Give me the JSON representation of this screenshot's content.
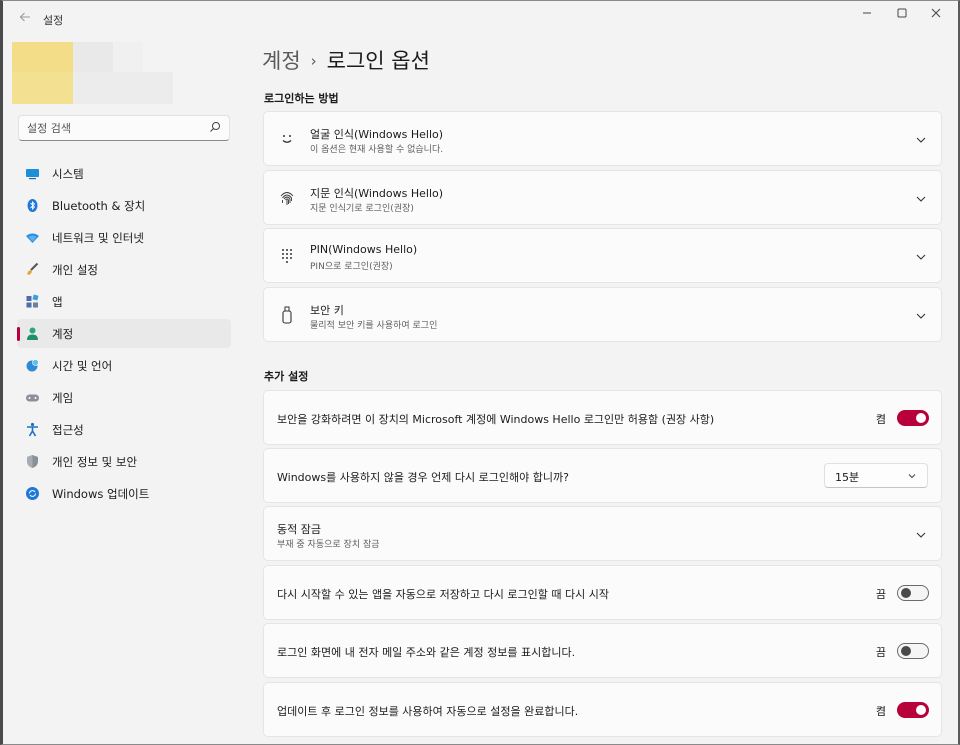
{
  "app": {
    "title": "설정"
  },
  "search": {
    "placeholder": "설정 검색"
  },
  "sidebar": {
    "items": [
      {
        "label": "시스템",
        "icon": "system-icon"
      },
      {
        "label": "Bluetooth & 장치",
        "icon": "bluetooth-icon"
      },
      {
        "label": "네트워크 및 인터넷",
        "icon": "network-icon"
      },
      {
        "label": "개인 설정",
        "icon": "brush-icon"
      },
      {
        "label": "앱",
        "icon": "apps-icon"
      },
      {
        "label": "계정",
        "icon": "account-icon",
        "active": true
      },
      {
        "label": "시간 및 언어",
        "icon": "globe-clock-icon"
      },
      {
        "label": "게임",
        "icon": "gamepad-icon"
      },
      {
        "label": "접근성",
        "icon": "accessibility-icon"
      },
      {
        "label": "개인 정보 및 보안",
        "icon": "shield-icon"
      },
      {
        "label": "Windows 업데이트",
        "icon": "update-icon"
      }
    ]
  },
  "breadcrumb": {
    "parent": "계정",
    "separator": "›",
    "current": "로그인 옵션"
  },
  "sections": {
    "signin_methods": {
      "title": "로그인하는 방법",
      "items": [
        {
          "title": "얼굴 인식(Windows Hello)",
          "subtitle": "이 옵션은 현재 사용할 수 없습니다.",
          "icon": "face-icon"
        },
        {
          "title": "지문 인식(Windows Hello)",
          "subtitle": "지문 인식기로 로그인(권장)",
          "icon": "fingerprint-icon"
        },
        {
          "title": "PIN(Windows Hello)",
          "subtitle": "PIN으로 로그인(권장)",
          "icon": "pin-keypad-icon"
        },
        {
          "title": "보안 키",
          "subtitle": "물리적 보안 키를 사용하여 로그인",
          "icon": "security-key-icon"
        }
      ]
    },
    "additional": {
      "title": "추가 설정",
      "hello_only": {
        "text": "보안을 강화하려면 이 장치의 Microsoft 계정에 Windows Hello 로그인만 허용함 (권장 사항)",
        "state": "켬",
        "on": true
      },
      "away": {
        "text": "Windows를 사용하지 않을 경우 언제 다시 로그인해야 합니까?",
        "value": "15분"
      },
      "dynamic_lock": {
        "title": "동적 잠금",
        "subtitle": "부재 중 자동으로 장치 잠금"
      },
      "restart_apps": {
        "text": "다시 시작할 수 있는 앱을 자동으로 저장하고 다시 로그인할 때 다시 시작",
        "state": "끔",
        "on": false
      },
      "show_email": {
        "text": "로그인 화면에 내 전자 메일 주소와 같은 계정 정보를 표시합니다.",
        "state": "끔",
        "on": false
      },
      "after_update": {
        "text": "업데이트 후 로그인 정보를 사용하여 자동으로 설정을 완료합니다.",
        "state": "켬",
        "on": true
      }
    }
  },
  "colors": {
    "accent": "#b8003b",
    "background": "#f3f3f3",
    "card": "#fbfbfb"
  }
}
